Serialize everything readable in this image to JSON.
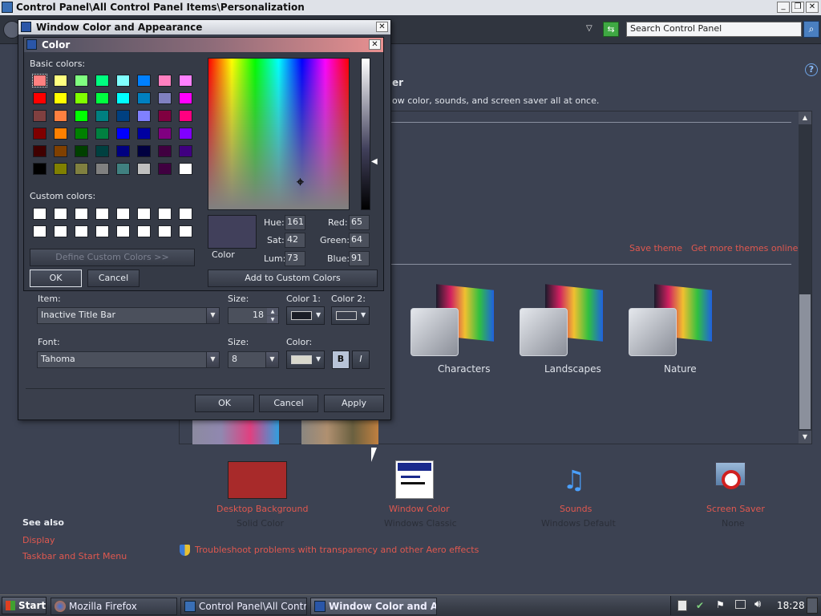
{
  "explorer": {
    "title": "Control Panel\\All Control Panel Items\\Personalization",
    "search_placeholder": "Search Control Panel",
    "heading_fragment": "er",
    "desc_fragment": "ow color, sounds, and screen saver all at once.",
    "save_theme": "Save theme",
    "get_more": "Get more themes online",
    "themes": [
      {
        "label": "Characters"
      },
      {
        "label": "Landscapes"
      },
      {
        "label": "Nature"
      }
    ],
    "bottom_items": [
      {
        "label": "Desktop Background",
        "sub": "Solid Color"
      },
      {
        "label": "Window Color",
        "sub": "Windows Classic"
      },
      {
        "label": "Sounds",
        "sub": "Windows Default"
      },
      {
        "label": "Screen Saver",
        "sub": "None"
      }
    ],
    "see_also": "See also",
    "see_also_links": [
      "Display",
      "Taskbar and Start Menu"
    ],
    "troubleshoot": "Troubleshoot problems with transparency and other Aero effects",
    "desktop_bg_color": "#a82a2a"
  },
  "wca": {
    "title": "Window Color and Appearance",
    "item_label": "Item:",
    "item_value": "Inactive Title Bar",
    "size_label": "Size:",
    "size_value": "18",
    "color1_label": "Color 1:",
    "color2_label": "Color 2:",
    "font_label": "Font:",
    "font_value": "Tahoma",
    "font_size_label": "Size:",
    "font_size_value": "8",
    "font_color_label": "Color:",
    "bold": "B",
    "italic": "I",
    "ok": "OK",
    "cancel": "Cancel",
    "apply": "Apply"
  },
  "color": {
    "title": "Color",
    "basic_label": "Basic colors:",
    "custom_label": "Custom colors:",
    "define_btn": "Define Custom Colors >>",
    "ok": "OK",
    "cancel": "Cancel",
    "add_btn": "Add to Custom Colors",
    "color_label": "Color",
    "hue_label": "Hue:",
    "hue": "161",
    "sat_label": "Sat:",
    "sat": "42",
    "lum_label": "Lum:",
    "lum": "73",
    "red_label": "Red:",
    "red": "65",
    "green_label": "Green:",
    "green": "64",
    "blue_label": "Blue:",
    "blue": "91",
    "preview_color": "#41405b",
    "basic_colors": [
      "#ff8080",
      "#ffff80",
      "#80ff80",
      "#00ff80",
      "#80ffff",
      "#0080ff",
      "#ff80c0",
      "#ff80ff",
      "#ff0000",
      "#ffff00",
      "#80ff00",
      "#00ff40",
      "#00ffff",
      "#0080c0",
      "#8080c0",
      "#ff00ff",
      "#804040",
      "#ff8040",
      "#00ff00",
      "#008080",
      "#004080",
      "#8080ff",
      "#800040",
      "#ff0080",
      "#800000",
      "#ff8000",
      "#008000",
      "#008040",
      "#0000ff",
      "#0000a0",
      "#800080",
      "#8000ff",
      "#400000",
      "#804000",
      "#004000",
      "#004040",
      "#000080",
      "#000040",
      "#400040",
      "#400080",
      "#000000",
      "#808000",
      "#808040",
      "#808080",
      "#408080",
      "#c0c0c0",
      "#400040",
      "#ffffff"
    ]
  },
  "taskbar": {
    "start": "Start",
    "items": [
      "Mozilla Firefox",
      "Control Panel\\All Control ...",
      "Window Color and Ap..."
    ],
    "clock": "18:28"
  }
}
